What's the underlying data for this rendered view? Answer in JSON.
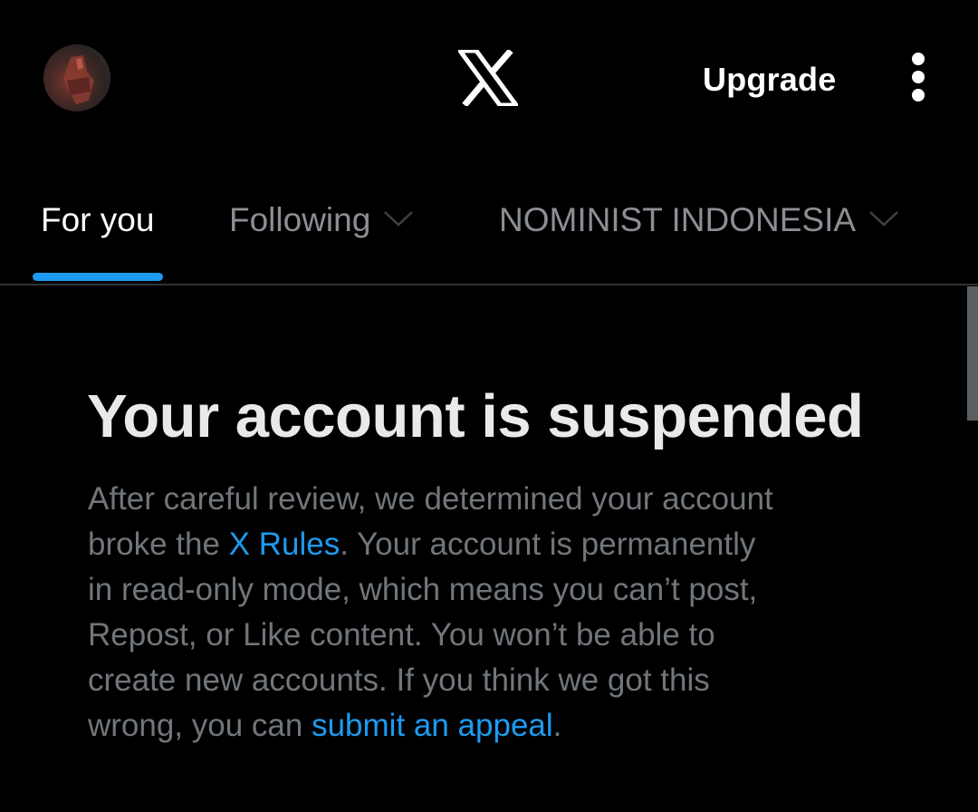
{
  "header": {
    "avatar_alt": "Profile",
    "logo_icon": "x-logo-icon",
    "upgrade_label": "Upgrade",
    "more_icon": "more-vertical-icon"
  },
  "tabs": [
    {
      "label": "For you",
      "active": true
    },
    {
      "label": "Following",
      "active": false,
      "icon": "chevron-down-icon"
    },
    {
      "label": "NOMINIST INDONESIA",
      "active": false,
      "icon": "chevron-down-icon"
    }
  ],
  "notice": {
    "title": "Your account is suspended",
    "line1": "After careful review, we determined your account",
    "line2_pre": "broke the ",
    "rules_link": "X Rules",
    "line2_post": ". Your account is permanently",
    "line3": "in read-only mode, which means you can’t post,",
    "line4": "Repost, or Like content. You won’t be able to",
    "line5": "create new accounts. If you think we got this",
    "line6_pre": "wrong, you can ",
    "appeal_link": "submit an appeal",
    "line6_post": "."
  },
  "colors": {
    "background": "#000000",
    "accent": "#1d9bf0",
    "text_primary": "#e7e9ea",
    "text_secondary": "#71767b"
  }
}
